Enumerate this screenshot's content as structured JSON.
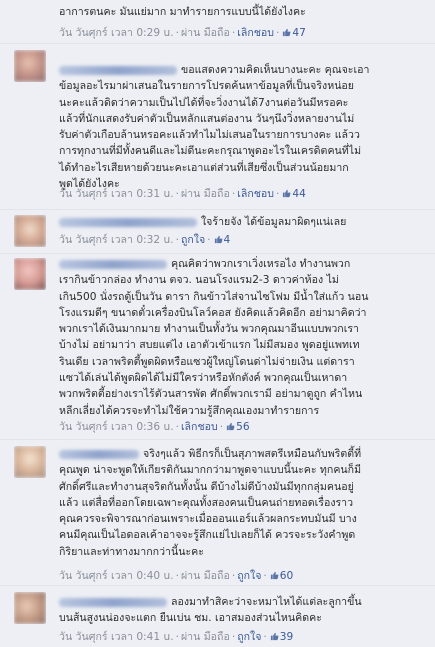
{
  "comments": [
    {
      "lines": [
        "อาการตนคะ มันแย่มาก มาทำรายการแบบนี้ได้ยังไงคะ"
      ],
      "time": "วัน วันศุกร์ เวลา 0:29 u.",
      "flag": "ผ่าน มือถือ",
      "action": "เลิกชอบ",
      "likes": "47"
    },
    {
      "lines": [
        "ขอแสดงความคิดเห็นบางนะคะ คุณจะเอา",
        "ข้อมูลอะไรมาผ่าเสนอในรายการโปรดค้นหาข้อมูลที่เป็นจริงหน่อย",
        "นะคะแล้วดิดว่าความเป็นไปได้ที่จะวิ่งงานได้7งานต่อวันมีหรอคะ",
        "แล้วที่นักแสดงรับค่าตัวเป็นหลักแสนต่องาน วันๆนึงวิ่งหลายงานไม่",
        "รับค่าตัวเกือบล้านหรอคะแล้วทำไมไม่เสนอในรายการบางคะ แล้วว",
        "การทุกงานที่มีทั้งคนดีและไม่ดีนะคะกรุณาพูดอะไรในเครดิตคนที่ไม่",
        "ได้ทำอะไรเสียหายด้วยนะคะเอาแต่ส่วนที่เสียซึ่งเป็นส่วนน้อยมาก",
        "พูดได้ยังไงคะ"
      ],
      "time": "วัน วันศุกร์ เวลา 0:31 u.",
      "flag": "ผ่าน มือถือ",
      "action": "เลิกชอบ",
      "likes": "44"
    },
    {
      "lines": [
        "ใจร้ายจัง ได้ข้อมูลมาผิดๆแน่เลย"
      ],
      "time": "วัน วันศุกร์ เวลา 0:32 u.",
      "flag": "",
      "action": "ถูกใจ",
      "likes": "4"
    },
    {
      "lines": [
        "คุณคิดว่าพวกเราเวิ่งเหรอไง ทำงานพวก",
        "เรากินข้าวกล่อง ทำงาน ตจว. นอนโรงแรม2-3 ดาวค่าห้อง ไม่",
        "เกิน500 นั่งรถตู้เป็นวัน ดารา กินข้าวไส่จานไซโฟม มีน้ำใส่แก้ว นอน",
        "โรงแรมดีๆ ขนาดตั๋วเครื่องบินโลว์คอส ยังคิดแล้วคิดอีก อย่ามาคิดว่า",
        "พวกเราได้เงินมากมาย ทำงานเป็นทั้งวัน พวกคุณมาอีนแบบพวกเรา",
        "บ้างไม่ อย่ามาว่า สบยแต่ไง เอาตัวเข้าแรก ไม่มีสมอง พูดอยู่แพทเท",
        "รินเดีย เวลาพริตตี้พูดผิดหรือแซวผู้ใหญ่โดนด่าไม่จ่ายเงิน แต่ดารา",
        "แซวได้เล่นได้พูดผิดได้ไม่มีใครว่าหรือหักตังค์ พวกคุณเป็นเหาดา",
        "พวกพริตตี้อย่างเราไร้ตัวนสารพัด ศักดิ์พวกเรามี อย่ามาดูถูก คำไหน",
        "หลีกเลี่ยงได้ควรจะทำไม่ใช้ความรู้สึกคุณเองมาทำรายการ"
      ],
      "time": "วัน วันศุกร์ เวลา 0:36 u.",
      "flag": "",
      "action": "เลิกชอบ",
      "likes": "56"
    },
    {
      "lines": [
        "จริงๆแล้ว พิธีกรก็เป็นสุภาพสตรีเหมือนกับพริตตี้ที่",
        "คุณพูด น่าจะพูดให้เกียรติกันมากกว่ามาพูดจาแบบนี้นะคะ ทุกคนก็มี",
        "ศักดิ์ศรีและทำงานสุจริตกันทั้งนั้น ดีบ้างไม่ดีบ้างมันมีทุกกลุ่มคนอยู่",
        "แล้ว แต่สื่อที่ออกโดยเฉพาะคุณทั้งสองคนเป็นคนถ่ายทอดเรื่องราว",
        "คุณควรจะพิจารณาก่อนเพราะเมื่อออนแอร์แล้วผลกระทบมันมี บาง",
        "คนมีคุณเป็นไอดอลเค้าอาจจะรู้สึกแย่ไปเลยก็ได้ ควรจะระวังคำพูด",
        "กิริยาและท่าทางมากกว่านี้นะคะ"
      ],
      "time": "วัน วันศุกร์ เวลา 0:40 u.",
      "flag": "ผ่าน มือถือ",
      "action": "ถูกใจ",
      "likes": "60"
    },
    {
      "lines": [
        "ลองมาทำสิคะว่าจะหมาไหได้แต่ละลูกาขึ้น",
        "บนส้นสูงนน่องจะแตก ยืนเบ่น ชม. เอาสมองส่วนไหนคิดคะ"
      ],
      "time": "วัน วันศุกร์ เวลา 0:41 u.",
      "flag": "ผ่าน มือถือ",
      "action": "ถูกใจ",
      "likes": "39"
    }
  ]
}
